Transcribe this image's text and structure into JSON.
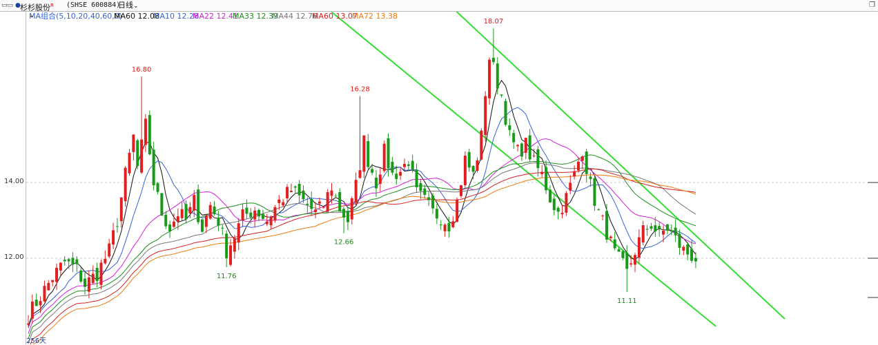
{
  "titlebar": {
    "grip": "▭▭",
    "dot": "●",
    "stock_name": "杉杉股份",
    "stock_mark": "R",
    "code": "(SHSE 600884)",
    "period": "日线",
    "period_icon": "chevron-down-icon",
    "window_icon": "window-restore-icon"
  },
  "legend": {
    "group": "MA组合(5,10,20,40,60,0)",
    "group_icon": "chevron-down-icon",
    "items": [
      {
        "label": "MA60 12.08",
        "color": "#111111"
      },
      {
        "label": "MA10 12.28",
        "color": "#3a62d8"
      },
      {
        "label": "MA22 12.41",
        "color": "#d61fd6"
      },
      {
        "label": "MA33 12.39",
        "color": "#1a8f1a"
      },
      {
        "label": "MA44 12.76",
        "color": "#777777"
      },
      {
        "label": "MA60 13.07",
        "color": "#d42020"
      },
      {
        "label": "MA72 13.38",
        "color": "#ee7a10"
      }
    ]
  },
  "footer": {
    "days": "256天"
  },
  "colors": {
    "up": "#e02020",
    "down": "#1a9a1a",
    "channel": "#33dd33",
    "grid": "#c8c8c8",
    "peak_label": "#e01818",
    "trough_label": "#1a8a1a"
  },
  "chart_data": {
    "type": "candlestick",
    "y_axis_ticks": [
      {
        "value": 14.0,
        "label": "14.00"
      },
      {
        "value": 12.0,
        "label": "12.00"
      }
    ],
    "ylim": [
      10.3,
      19.2
    ],
    "bar_count": 166,
    "grid": "horizontal dashed at tick values",
    "annotations": [
      {
        "label": "16.80",
        "bar": 28,
        "value": 16.8,
        "kind": "high"
      },
      {
        "label": "11.76",
        "bar": 49,
        "value": 11.76,
        "kind": "low"
      },
      {
        "label": "12.66",
        "bar": 78,
        "value": 12.66,
        "kind": "low"
      },
      {
        "label": "16.28",
        "bar": 82,
        "value": 16.28,
        "kind": "high"
      },
      {
        "label": "18.07",
        "bar": 115,
        "value": 18.07,
        "kind": "high"
      },
      {
        "label": "11.11",
        "bar": 148,
        "value": 11.11,
        "kind": "low"
      }
    ],
    "channel_lines": [
      {
        "from": {
          "bar": 75,
          "value": 18.5
        },
        "to": {
          "bar": 170,
          "value": 10.2
        }
      },
      {
        "from": {
          "bar": 99,
          "value": 19.2
        },
        "to": {
          "bar": 187,
          "value": 10.4
        }
      }
    ],
    "close_anchors": [
      [
        0,
        10.5
      ],
      [
        3,
        11.0
      ],
      [
        6,
        11.5
      ],
      [
        9,
        11.9
      ],
      [
        12,
        11.7
      ],
      [
        14,
        11.3
      ],
      [
        17,
        11.6
      ],
      [
        20,
        12.2
      ],
      [
        22,
        13.0
      ],
      [
        24,
        14.2
      ],
      [
        26,
        15.2
      ],
      [
        27,
        14.4
      ],
      [
        29,
        15.5
      ],
      [
        30,
        14.8
      ],
      [
        31,
        14.0
      ],
      [
        33,
        13.2
      ],
      [
        35,
        12.8
      ],
      [
        37,
        13.2
      ],
      [
        39,
        13.0
      ],
      [
        41,
        13.5
      ],
      [
        43,
        12.8
      ],
      [
        45,
        13.4
      ],
      [
        47,
        13.0
      ],
      [
        49,
        12.2
      ],
      [
        51,
        12.6
      ],
      [
        53,
        13.1
      ],
      [
        56,
        13.3
      ],
      [
        59,
        13.0
      ],
      [
        62,
        13.5
      ],
      [
        65,
        13.8
      ],
      [
        68,
        13.5
      ],
      [
        71,
        13.2
      ],
      [
        73,
        13.4
      ],
      [
        75,
        13.9
      ],
      [
        77,
        13.3
      ],
      [
        79,
        13.0
      ],
      [
        81,
        13.9
      ],
      [
        83,
        15.1
      ],
      [
        84,
        14.6
      ],
      [
        86,
        14.0
      ],
      [
        88,
        14.8
      ],
      [
        90,
        14.2
      ],
      [
        92,
        14.3
      ],
      [
        94,
        14.6
      ],
      [
        96,
        13.7
      ],
      [
        98,
        13.5
      ],
      [
        100,
        13.2
      ],
      [
        102,
        13.1
      ],
      [
        104,
        12.9
      ],
      [
        106,
        13.5
      ],
      [
        108,
        14.6
      ],
      [
        110,
        14.2
      ],
      [
        112,
        15.2
      ],
      [
        113,
        16.4
      ],
      [
        114,
        17.3
      ],
      [
        115,
        17.0
      ],
      [
        117,
        16.3
      ],
      [
        119,
        15.2
      ],
      [
        121,
        14.8
      ],
      [
        123,
        15.0
      ],
      [
        125,
        14.5
      ],
      [
        127,
        14.2
      ],
      [
        129,
        13.6
      ],
      [
        131,
        13.2
      ],
      [
        133,
        13.6
      ],
      [
        135,
        14.2
      ],
      [
        137,
        14.9
      ],
      [
        139,
        13.9
      ],
      [
        141,
        13.2
      ],
      [
        143,
        12.7
      ],
      [
        145,
        12.1
      ],
      [
        147,
        11.8
      ],
      [
        148,
        11.6
      ],
      [
        150,
        12.2
      ],
      [
        152,
        12.7
      ],
      [
        154,
        12.9
      ],
      [
        156,
        12.6
      ],
      [
        158,
        12.8
      ],
      [
        160,
        12.5
      ],
      [
        162,
        12.2
      ],
      [
        165,
        12.0
      ]
    ],
    "moving_averages": [
      {
        "name": "MA60",
        "color": "#111111",
        "width": 1.0
      },
      {
        "name": "MA10",
        "color": "#3a62d8",
        "width": 1.0
      },
      {
        "name": "MA22",
        "color": "#d61fd6",
        "width": 1.0
      },
      {
        "name": "MA33",
        "color": "#1a8f1a",
        "width": 1.0
      },
      {
        "name": "MA44",
        "color": "#777777",
        "width": 1.0
      },
      {
        "name": "MA60",
        "color": "#d42020",
        "width": 1.0
      },
      {
        "name": "MA72",
        "color": "#ee7a10",
        "width": 1.0
      }
    ]
  }
}
